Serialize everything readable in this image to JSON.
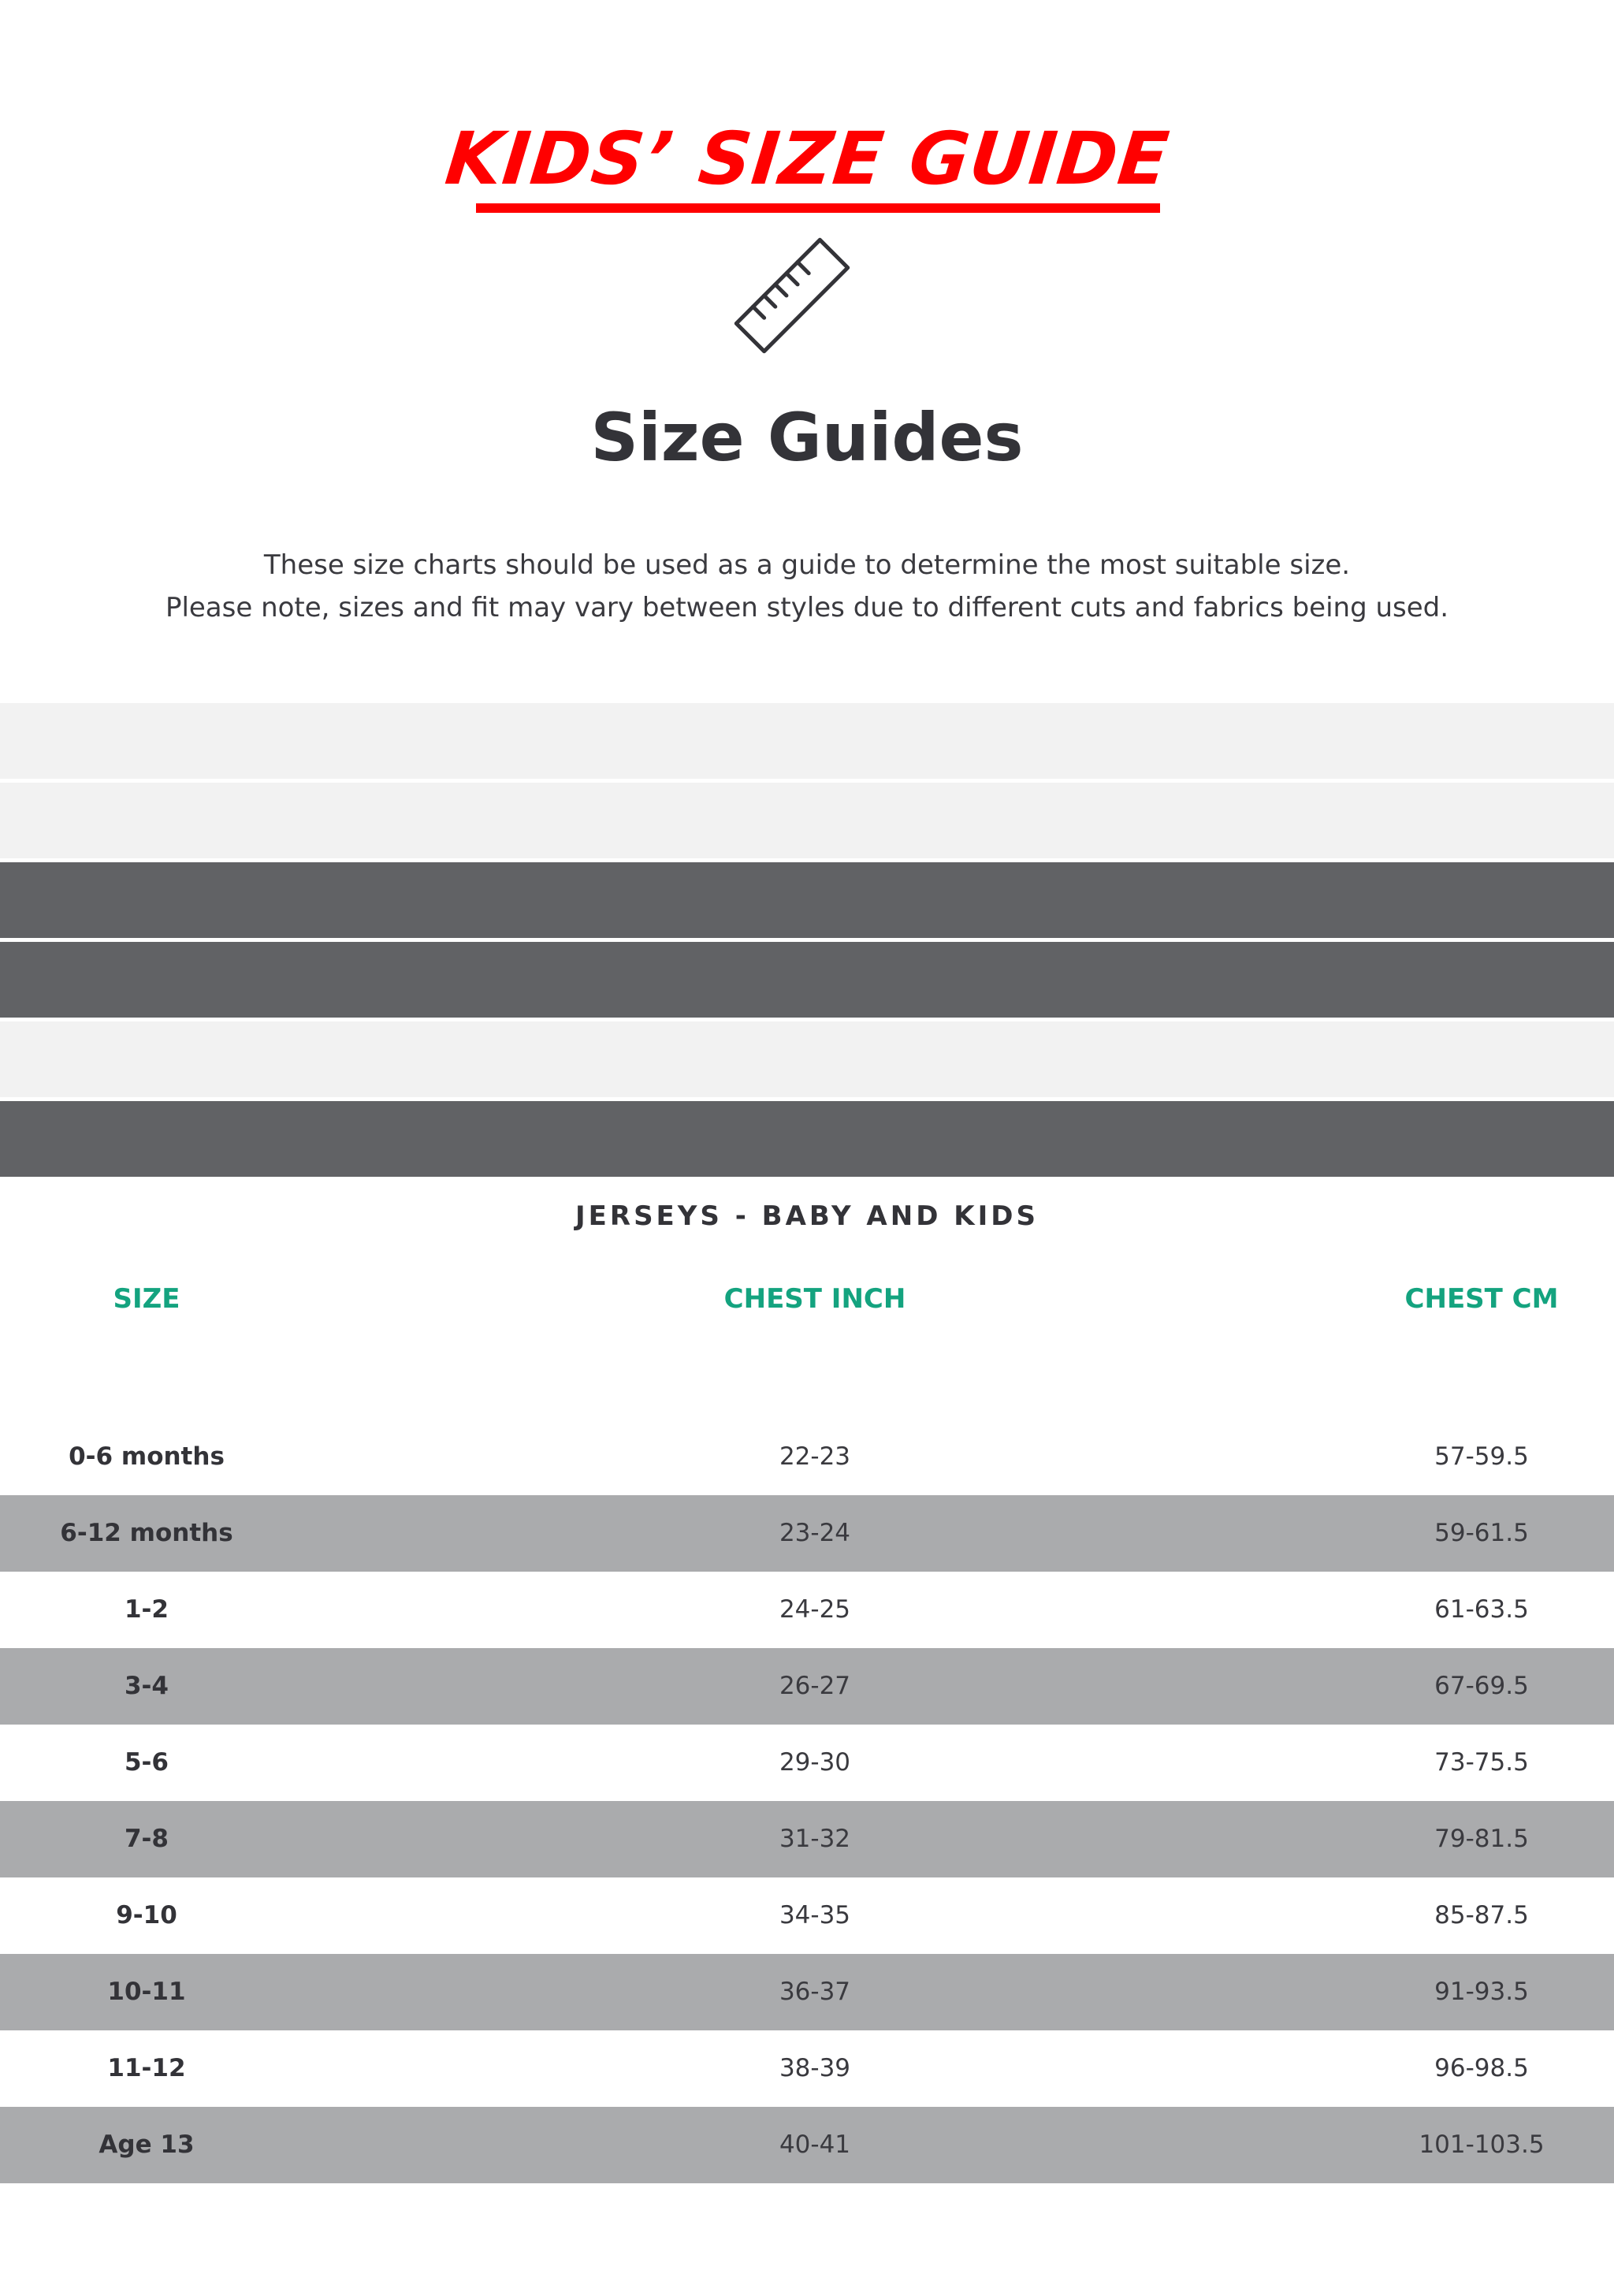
{
  "header": {
    "banner_title": "KIDS’ SIZE GUIDE",
    "heading": "Size Guides",
    "intro_lines": [
      "These size charts should be used as a guide to determine the most suitable size.",
      "Please note, sizes and fit may vary between styles due to different cuts and fabrics being used."
    ],
    "icon": "ruler-icon"
  },
  "colors": {
    "accent_red": "#ff0000",
    "header_green": "#14a37f",
    "bar_light": "#f2f2f2",
    "bar_dark": "#616265",
    "row_stripe": "#aaabad"
  },
  "table": {
    "title": "JERSEYS - BABY AND KIDS",
    "columns": [
      "SIZE",
      "CHEST INCH",
      "CHEST CM"
    ],
    "rows": [
      {
        "size": "0-6 months",
        "inch": "22-23",
        "cm": "57-59.5"
      },
      {
        "size": "6-12 months",
        "inch": "23-24",
        "cm": "59-61.5"
      },
      {
        "size": "1-2",
        "inch": "24-25",
        "cm": "61-63.5"
      },
      {
        "size": "3-4",
        "inch": "26-27",
        "cm": "67-69.5"
      },
      {
        "size": "5-6",
        "inch": "29-30",
        "cm": "73-75.5"
      },
      {
        "size": "7-8",
        "inch": "31-32",
        "cm": "79-81.5"
      },
      {
        "size": "9-10",
        "inch": "34-35",
        "cm": "85-87.5"
      },
      {
        "size": "10-11",
        "inch": "36-37",
        "cm": "91-93.5"
      },
      {
        "size": "11-12",
        "inch": "38-39",
        "cm": "96-98.5"
      },
      {
        "size": "Age 13",
        "inch": "40-41",
        "cm": "101-103.5"
      }
    ]
  }
}
